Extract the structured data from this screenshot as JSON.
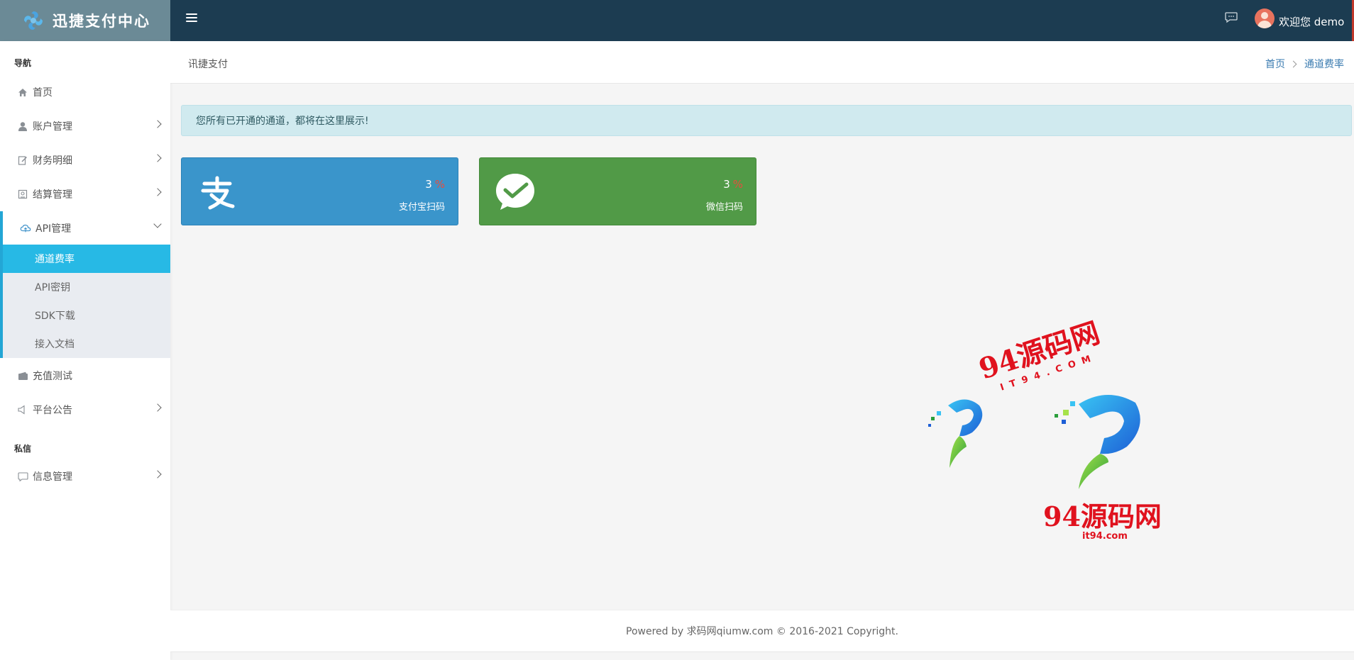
{
  "app": {
    "title": "迅捷支付中心"
  },
  "topbar": {
    "welcome": "欢迎您 demo"
  },
  "sidebar": {
    "section_nav": "导航",
    "section_private": "私信",
    "items": [
      {
        "label": "首页",
        "icon": "home-icon"
      },
      {
        "label": "账户管理",
        "icon": "user-icon"
      },
      {
        "label": "财务明细",
        "icon": "edit-icon"
      },
      {
        "label": "结算管理",
        "icon": "settle-icon"
      },
      {
        "label": "API管理",
        "icon": "cloud-icon"
      },
      {
        "label": "充值测试",
        "icon": "wallet-icon"
      },
      {
        "label": "平台公告",
        "icon": "volume-icon"
      },
      {
        "label": "信息管理",
        "icon": "message-icon"
      }
    ],
    "api_sub": [
      "通道费率",
      "API密钥",
      "SDK下载",
      "接入文档"
    ]
  },
  "breadcrumb": {
    "title": "讯捷支付",
    "home": "首页",
    "current": "通道费率"
  },
  "alert": "您所有已开通的通道，都将在这里展示!",
  "cards": [
    {
      "rate": "3",
      "unit": "%",
      "label": "支付宝扫码",
      "icon": "alipay-icon",
      "color": "#3a95cb"
    },
    {
      "rate": "3",
      "unit": "%",
      "label": "微信扫码",
      "icon": "wechat-icon",
      "color": "#519a47"
    }
  ],
  "watermark": {
    "text1": "94源码网",
    "sub1": "IT94.COM",
    "text2": "94源码网",
    "sub2": "it94.com"
  },
  "footer": "Powered by 求码网qiumw.com © 2016-2021 Copyright."
}
